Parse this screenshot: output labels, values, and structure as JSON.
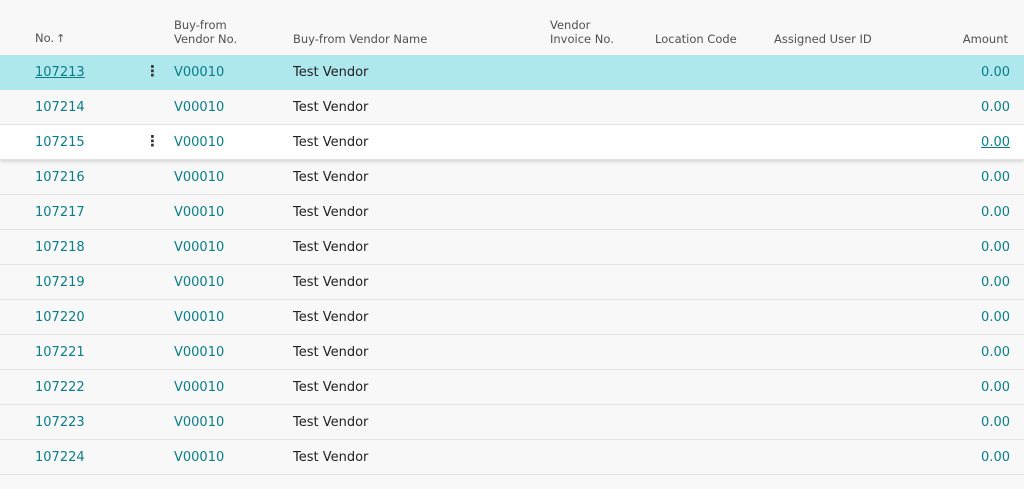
{
  "columns": {
    "no": "No.",
    "vendor_no_line1": "Buy-from",
    "vendor_no_line2": "Vendor No.",
    "vendor_name": "Buy-from Vendor Name",
    "vendor_invoice_line1": "Vendor",
    "vendor_invoice_line2": "Invoice No.",
    "location_code": "Location Code",
    "assigned_user": "Assigned User ID",
    "amount": "Amount",
    "sort_icon": "arrow-up-icon"
  },
  "row_menu_glyph": "⋮",
  "rows": [
    {
      "no": "107213",
      "vendor_no": "V00010",
      "vendor_name": "Test Vendor",
      "amount": "0.00"
    },
    {
      "no": "107214",
      "vendor_no": "V00010",
      "vendor_name": "Test Vendor",
      "amount": "0.00"
    },
    {
      "no": "107215",
      "vendor_no": "V00010",
      "vendor_name": "Test Vendor",
      "amount": "0.00"
    },
    {
      "no": "107216",
      "vendor_no": "V00010",
      "vendor_name": "Test Vendor",
      "amount": "0.00"
    },
    {
      "no": "107217",
      "vendor_no": "V00010",
      "vendor_name": "Test Vendor",
      "amount": "0.00"
    },
    {
      "no": "107218",
      "vendor_no": "V00010",
      "vendor_name": "Test Vendor",
      "amount": "0.00"
    },
    {
      "no": "107219",
      "vendor_no": "V00010",
      "vendor_name": "Test Vendor",
      "amount": "0.00"
    },
    {
      "no": "107220",
      "vendor_no": "V00010",
      "vendor_name": "Test Vendor",
      "amount": "0.00"
    },
    {
      "no": "107221",
      "vendor_no": "V00010",
      "vendor_name": "Test Vendor",
      "amount": "0.00"
    },
    {
      "no": "107222",
      "vendor_no": "V00010",
      "vendor_name": "Test Vendor",
      "amount": "0.00"
    },
    {
      "no": "107223",
      "vendor_no": "V00010",
      "vendor_name": "Test Vendor",
      "amount": "0.00"
    },
    {
      "no": "107224",
      "vendor_no": "V00010",
      "vendor_name": "Test Vendor",
      "amount": "0.00"
    }
  ],
  "colors": {
    "link": "#0a7e88",
    "selected_row": "#aee7ec",
    "background": "#f8f8f8"
  }
}
